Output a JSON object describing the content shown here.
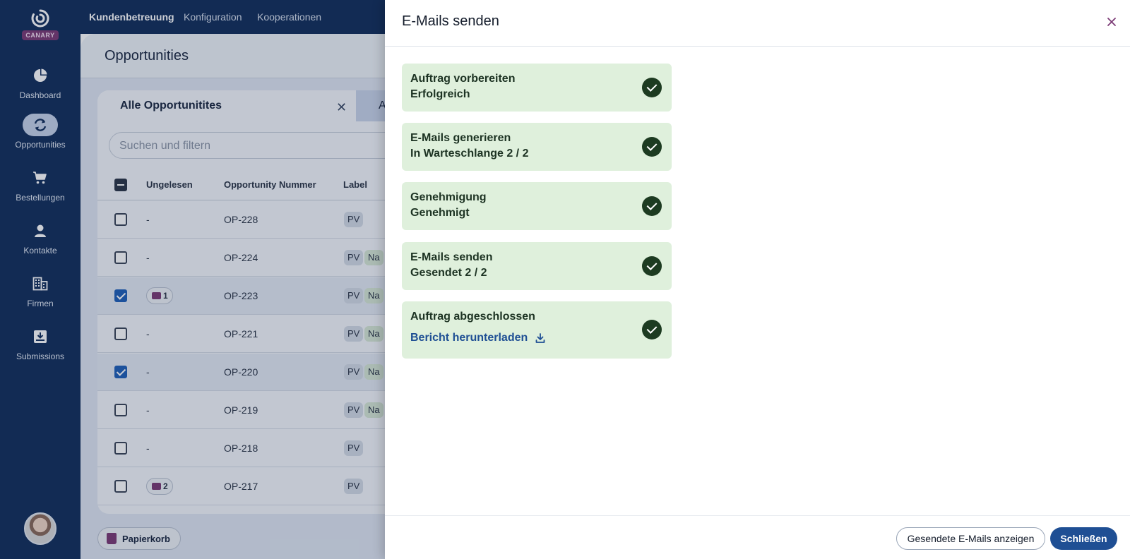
{
  "app": {
    "logo_badge": "CANARY"
  },
  "sidebar": {
    "items": [
      {
        "label": "Dashboard",
        "icon": "pie-chart-icon",
        "active": false
      },
      {
        "label": "Opportunities",
        "icon": "refresh-icon",
        "active": true
      },
      {
        "label": "Bestellungen",
        "icon": "cart-icon",
        "active": false
      },
      {
        "label": "Kontakte",
        "icon": "person-icon",
        "active": false
      },
      {
        "label": "Firmen",
        "icon": "building-icon",
        "active": false
      },
      {
        "label": "Submissions",
        "icon": "inbox-icon",
        "active": false
      }
    ]
  },
  "topnav": {
    "items": [
      "Kundenbetreuung",
      "Konfiguration",
      "Kooperationen"
    ],
    "active": "Kundenbetreuung"
  },
  "page": {
    "title": "Opportunities",
    "tab_label": "Alle Opportunitites",
    "tab_next_label": "A",
    "search_placeholder": "Suchen und filtern",
    "columns": [
      "Ungelesen",
      "Opportunity Nummer",
      "Label"
    ],
    "rows": [
      {
        "checked": false,
        "unread": "-",
        "number": "OP-228",
        "labels": [
          "PV"
        ]
      },
      {
        "checked": false,
        "unread": "-",
        "number": "OP-224",
        "labels": [
          "PV",
          "Na"
        ]
      },
      {
        "checked": true,
        "unread": "1",
        "number": "OP-223",
        "labels": [
          "PV",
          "Na"
        ]
      },
      {
        "checked": false,
        "unread": "-",
        "number": "OP-221",
        "labels": [
          "PV",
          "Na"
        ]
      },
      {
        "checked": true,
        "unread": "-",
        "number": "OP-220",
        "labels": [
          "PV",
          "Na"
        ]
      },
      {
        "checked": false,
        "unread": "-",
        "number": "OP-219",
        "labels": [
          "PV",
          "Na"
        ]
      },
      {
        "checked": false,
        "unread": "-",
        "number": "OP-218",
        "labels": [
          "PV"
        ]
      },
      {
        "checked": false,
        "unread": "2",
        "number": "OP-217",
        "labels": [
          "PV"
        ]
      }
    ],
    "trash_label": "Papierkorb"
  },
  "drawer": {
    "title": "E-Mails senden",
    "steps": [
      {
        "title": "Auftrag vorbereiten",
        "status": "Erfolgreich"
      },
      {
        "title": "E-Mails generieren",
        "status": "In Warteschlange 2 / 2"
      },
      {
        "title": "Genehmigung",
        "status": "Genehmigt"
      },
      {
        "title": "E-Mails senden",
        "status": "Gesendet 2 / 2"
      },
      {
        "title": "Auftrag abgeschlossen",
        "link": "Bericht herunterladen"
      }
    ],
    "secondary_button": "Gesendete E-Mails anzeigen",
    "primary_button": "Schließen"
  },
  "colors": {
    "nav_bg": "#132f5c",
    "accent": "#1f4f94",
    "success_bg": "#dff0dc",
    "brand": "#7b3a75"
  }
}
